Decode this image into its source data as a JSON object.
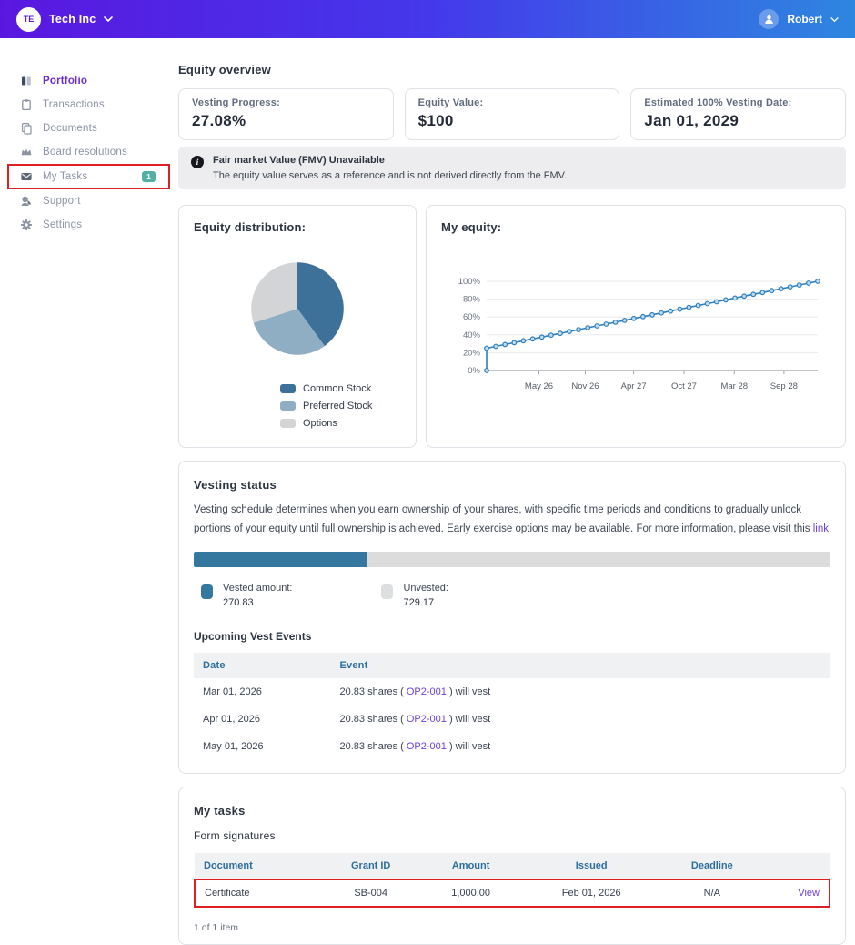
{
  "header": {
    "company_initials": "TE",
    "company_name": "Tech Inc",
    "user_name": "Robert"
  },
  "sidebar": {
    "items": [
      {
        "label": "Portfolio",
        "icon": "portfolio-icon",
        "active": true
      },
      {
        "label": "Transactions",
        "icon": "clipboard-icon",
        "active": false
      },
      {
        "label": "Documents",
        "icon": "documents-icon",
        "active": false
      },
      {
        "label": "Board resolutions",
        "icon": "crown-icon",
        "active": false
      },
      {
        "label": "My Tasks",
        "icon": "envelope-icon",
        "active": false,
        "badge": "1",
        "highlighted": true
      },
      {
        "label": "Support",
        "icon": "support-icon",
        "active": false
      },
      {
        "label": "Settings",
        "icon": "gear-icon",
        "active": false
      }
    ]
  },
  "overview": {
    "title": "Equity overview",
    "stats": [
      {
        "label": "Vesting Progress:",
        "value": "27.08%"
      },
      {
        "label": "Equity Value:",
        "value": "$100"
      },
      {
        "label": "Estimated 100% Vesting Date:",
        "value": "Jan 01, 2029"
      }
    ]
  },
  "fmv_banner": {
    "icon": "info-icon",
    "title": "Fair market Value (FMV) Unavailable",
    "subtitle": "The equity value serves as a reference and is not derived directly from the FMV."
  },
  "chart_data": [
    {
      "type": "pie",
      "title": "Equity distribution:",
      "labels": [
        "Common Stock",
        "Preferred Stock",
        "Options"
      ],
      "values": [
        40,
        30,
        30
      ],
      "colors": [
        "#3D7199",
        "#8FAEC3",
        "#D2D4D5"
      ],
      "legend_position": "bottom"
    },
    {
      "type": "line",
      "title": "My equity:",
      "color": "#2E7FBE",
      "marker_fill": "#BFDCF0",
      "ylim": [
        0,
        100
      ],
      "y_ticks": [
        "0%",
        "20%",
        "40%",
        "60%",
        "80%",
        "100%"
      ],
      "x_tick_labels": [
        "May 26",
        "Nov 26",
        "Apr 27",
        "Oct 27",
        "Mar 28",
        "Sep 28"
      ],
      "x_tick_fractions": [
        0.158,
        0.298,
        0.444,
        0.596,
        0.748,
        0.898
      ],
      "x_months": [
        0,
        0,
        1,
        2,
        3,
        4,
        5,
        6,
        7,
        8,
        9,
        10,
        11,
        12,
        13,
        14,
        15,
        16,
        17,
        18,
        19,
        20,
        21,
        22,
        23,
        24,
        25,
        26,
        27,
        28,
        29,
        30,
        31,
        32,
        33,
        34,
        35,
        36
      ],
      "values": [
        0,
        25,
        27.08,
        29.17,
        31.25,
        33.33,
        35.42,
        37.5,
        39.58,
        41.67,
        43.75,
        45.83,
        47.92,
        50,
        52.08,
        54.17,
        56.25,
        58.33,
        60.42,
        62.5,
        64.58,
        66.67,
        68.75,
        70.83,
        72.92,
        75,
        77.08,
        79.17,
        81.25,
        83.33,
        85.42,
        87.5,
        89.58,
        91.67,
        93.75,
        95.83,
        97.92,
        100
      ],
      "grid": true
    }
  ],
  "vesting": {
    "title": "Vesting status",
    "description_pre": "Vesting schedule determines when you earn ownership of your shares, with specific time periods and conditions to gradually unlock portions of your equity until full ownership is achieved. Early exercise options may be available. For more information, please visit this ",
    "link_text": "link",
    "progress_percent": 27.08,
    "vested_label": "Vested amount:",
    "vested_value": "270.83",
    "unvested_label": "Unvested:",
    "unvested_value": "729.17",
    "upcoming_title": "Upcoming Vest Events",
    "table": {
      "headers": [
        "Date",
        "Event"
      ],
      "rows": [
        {
          "date": "Mar 01, 2026",
          "event_pre": "20.83 shares ( ",
          "grant_id": "OP2-001",
          "event_post": " ) will vest"
        },
        {
          "date": "Apr 01, 2026",
          "event_pre": "20.83 shares ( ",
          "grant_id": "OP2-001",
          "event_post": " ) will vest"
        },
        {
          "date": "May 01, 2026",
          "event_pre": "20.83 shares ( ",
          "grant_id": "OP2-001",
          "event_post": " ) will vest"
        }
      ]
    }
  },
  "tasks": {
    "title": "My tasks",
    "subtitle": "Form signatures",
    "headers": [
      "Document",
      "Grant ID",
      "Amount",
      "Issued",
      "Deadline"
    ],
    "row": {
      "document": "Certificate",
      "grant_id": "SB-004",
      "amount": "1,000.00",
      "issued": "Feb 01, 2026",
      "deadline": "N/A",
      "action": "View"
    },
    "footer": "1 of 1 item"
  },
  "colors": {
    "header_gradient_start": "#5A17E0",
    "header_gradient_end": "#2E86E0",
    "accent_purple": "#6C41D8",
    "table_header_blue": "#2C6E9E",
    "progress_blue": "#35789F",
    "badge_teal": "#52AFA4",
    "highlight_red": "#E02020"
  }
}
